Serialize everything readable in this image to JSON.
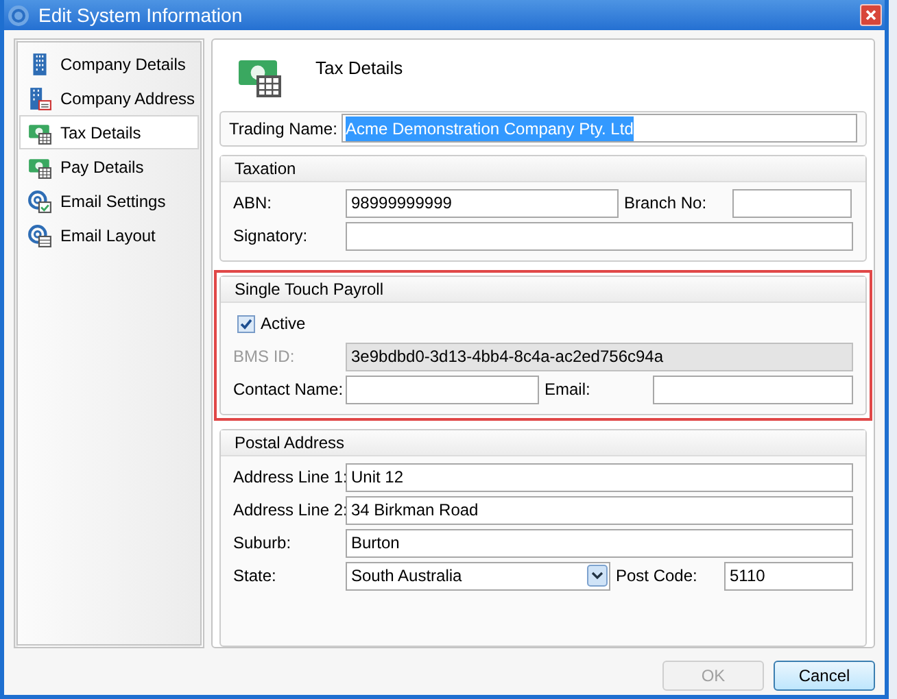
{
  "window": {
    "title": "Edit System Information"
  },
  "sidebar": {
    "items": [
      {
        "label": "Company Details",
        "selected": false
      },
      {
        "label": "Company Address",
        "selected": false
      },
      {
        "label": "Tax Details",
        "selected": true
      },
      {
        "label": "Pay Details",
        "selected": false
      },
      {
        "label": "Email Settings",
        "selected": false
      },
      {
        "label": "Email Layout",
        "selected": false
      }
    ]
  },
  "page": {
    "title": "Tax Details"
  },
  "trading_name": {
    "label": "Trading Name:",
    "value": "Acme Demonstration Company Pty. Ltd",
    "text_selected": true
  },
  "sections": [
    {
      "title": "Taxation",
      "highlighted": false,
      "rows": [
        [
          {
            "kind": "text",
            "label": "ABN:",
            "value": "98999999999",
            "disabled": false
          },
          {
            "kind": "text",
            "label": "Branch No:",
            "disabled": false
          }
        ],
        [
          {
            "kind": "text",
            "label": "Signatory:",
            "disabled": false
          }
        ]
      ]
    },
    {
      "title": "Single Touch Payroll",
      "highlighted": true,
      "rows": [
        [
          {
            "kind": "checkbox",
            "label": "Active",
            "checked": true
          }
        ],
        [
          {
            "kind": "text",
            "label": "BMS ID:",
            "value": "3e9bdbd0-3d13-4bb4-8c4a-ac2ed756c94a",
            "disabled": true
          }
        ],
        [
          {
            "kind": "text",
            "label": "Contact Name:",
            "disabled": false
          },
          {
            "kind": "text",
            "label": "Email:",
            "disabled": false
          }
        ]
      ]
    },
    {
      "title": "Postal Address",
      "highlighted": false,
      "rows": [
        [
          {
            "kind": "text",
            "label": "Address Line 1:",
            "value": "Unit 12",
            "disabled": false
          }
        ],
        [
          {
            "kind": "text",
            "label": "Address Line 2:",
            "value": "34 Birkman Road",
            "disabled": false
          }
        ],
        [
          {
            "kind": "text",
            "label": "Suburb:",
            "value": "Burton",
            "disabled": false
          }
        ],
        [
          {
            "kind": "select",
            "label": "State:",
            "value": "South Australia",
            "disabled": false
          },
          {
            "kind": "text",
            "label": "Post Code:",
            "value": "5110",
            "disabled": false
          }
        ]
      ]
    }
  ],
  "buttons": [
    {
      "label": "OK",
      "disabled": true
    },
    {
      "label": "Cancel",
      "disabled": false
    }
  ]
}
